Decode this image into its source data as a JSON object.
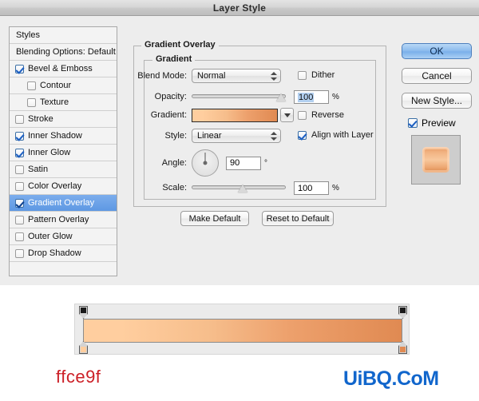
{
  "window": {
    "title": "Layer Style"
  },
  "styles_panel": {
    "header": "Styles",
    "blending_options": "Blending Options: Default",
    "items": [
      {
        "label": "Bevel & Emboss",
        "checked": true,
        "indent": false
      },
      {
        "label": "Contour",
        "checked": false,
        "indent": true
      },
      {
        "label": "Texture",
        "checked": false,
        "indent": true
      },
      {
        "label": "Stroke",
        "checked": false,
        "indent": false
      },
      {
        "label": "Inner Shadow",
        "checked": true,
        "indent": false
      },
      {
        "label": "Inner Glow",
        "checked": true,
        "indent": false
      },
      {
        "label": "Satin",
        "checked": false,
        "indent": false
      },
      {
        "label": "Color Overlay",
        "checked": false,
        "indent": false
      },
      {
        "label": "Gradient Overlay",
        "checked": true,
        "indent": false,
        "selected": true
      },
      {
        "label": "Pattern Overlay",
        "checked": false,
        "indent": false
      },
      {
        "label": "Outer Glow",
        "checked": false,
        "indent": false
      },
      {
        "label": "Drop Shadow",
        "checked": false,
        "indent": false
      }
    ]
  },
  "panel": {
    "outer_group_title": "Gradient Overlay",
    "inner_group_title": "Gradient",
    "blend_mode": {
      "label": "Blend Mode:",
      "value": "Normal"
    },
    "opacity": {
      "label": "Opacity:",
      "value": "100",
      "unit": "%",
      "percent": 100
    },
    "gradient": {
      "label": "Gradient:"
    },
    "style": {
      "label": "Style:",
      "value": "Linear"
    },
    "angle": {
      "label": "Angle:",
      "value": "90",
      "unit": "°",
      "degrees": 90
    },
    "scale": {
      "label": "Scale:",
      "value": "100",
      "unit": "%",
      "percent": 55
    },
    "dither": {
      "label": "Dither",
      "checked": false
    },
    "reverse": {
      "label": "Reverse",
      "checked": false
    },
    "align_with_layer": {
      "label": "Align with Layer",
      "checked": true
    },
    "make_default": "Make Default",
    "reset_default": "Reset to Default"
  },
  "actions": {
    "ok": "OK",
    "cancel": "Cancel",
    "new_style": "New Style...",
    "preview": {
      "label": "Preview",
      "checked": true
    }
  },
  "gradient_editor": {
    "opacity_stops": [
      {
        "position_pct": 0,
        "color": "#1a1a1a"
      },
      {
        "position_pct": 100,
        "color": "#1a1a1a"
      }
    ],
    "color_stops": [
      {
        "position_pct": 0,
        "color": "#ffce9f"
      },
      {
        "position_pct": 100,
        "color": "#e08a52"
      }
    ]
  },
  "captions": {
    "hex_value": "ffce9f",
    "watermark": "UiBQ.CoM"
  },
  "colors": {
    "accent_blue": "#5e98e3",
    "hex_text_red": "#cc2027",
    "watermark_blue": "#1166cc",
    "gradient_start": "#ffce9f",
    "gradient_end": "#e08a52"
  }
}
